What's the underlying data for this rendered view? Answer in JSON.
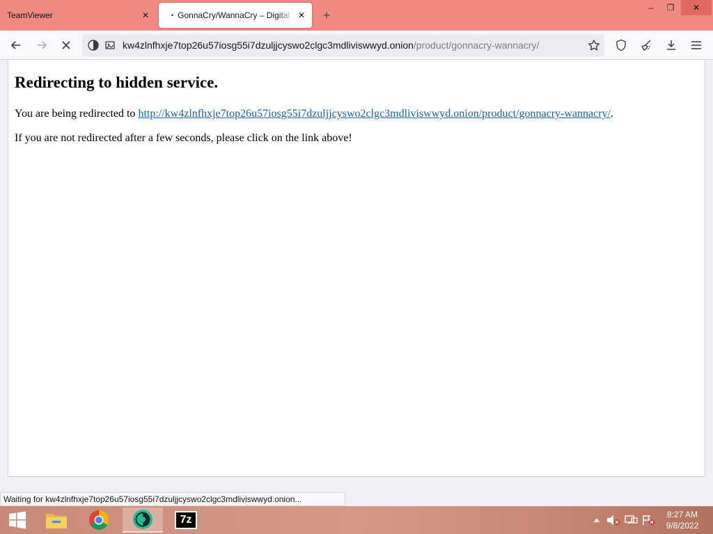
{
  "tabs": [
    {
      "title": "TeamViewer",
      "active": false
    },
    {
      "title": "GonnaCry/WannaCry – Digital Tor",
      "active": true,
      "loading_dot": "•"
    }
  ],
  "window_controls": {
    "minimize": "–",
    "restore": "❐",
    "close": "✕"
  },
  "navbar": {
    "back_icon": "arrow-left-icon",
    "forward_icon": "arrow-right-icon",
    "stop_icon": "close-icon",
    "url_host": "kw4zlnfhxje7top26u57iosg55i7dzuljjcyswo2clgc3mdliviswwyd.onion",
    "url_path": "/product/gonnacry-wannacry/"
  },
  "page": {
    "heading": "Redirecting to hidden service.",
    "redirect_prefix": "You are being redirected to ",
    "redirect_link": "http://kw4zlnfhxje7top26u57iosg55i7dzuljjcyswo2clgc3mdliviswwyd.onion/product/gonnacry-wannacry/",
    "redirect_suffix": ".",
    "fallback_text": "If you are not redirected after a few seconds, please click on the link above!"
  },
  "status_text": "Waiting for kw4zlnfhxje7top26u57iosg55i7dzuljjcyswo2clgc3mdliviswwyd.onion...",
  "taskbar": {
    "apps": [
      "file-explorer",
      "chrome",
      "tor-browser",
      "7zip"
    ],
    "seven_zip_label": "7z"
  },
  "clock": {
    "time": "8:27 AM",
    "date": "9/8/2022"
  },
  "colors": {
    "tabstrip": "#f08a82",
    "link": "#1a5fa8",
    "taskbar": "#d59a86"
  }
}
